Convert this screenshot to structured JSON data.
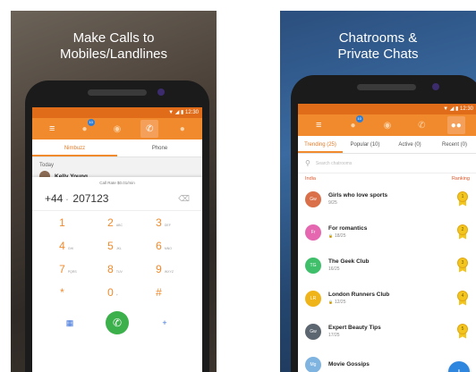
{
  "colors": {
    "accent": "#f08a2c",
    "statusbar": "#e06c19",
    "call_green": "#3cb04a",
    "fab_blue": "#2e86de",
    "ranking_red": "#e0582b"
  },
  "left": {
    "headline": [
      "Make Calls to",
      "Mobiles/Landlines"
    ],
    "status_time": "12:30",
    "tabs": {
      "nimbuzz": "Nimbuzz",
      "phone": "Phone"
    },
    "badge": "10",
    "today": "Today",
    "contact_name": "Kelly Young",
    "call_rate": "Call Rate $0.01/min",
    "country_code": "+44",
    "number": "207123",
    "keys": [
      {
        "digit": "1",
        "letters": ""
      },
      {
        "digit": "2",
        "letters": "ABC"
      },
      {
        "digit": "3",
        "letters": "DEF"
      },
      {
        "digit": "4",
        "letters": "GHI"
      },
      {
        "digit": "5",
        "letters": "JKL"
      },
      {
        "digit": "6",
        "letters": "MNO"
      },
      {
        "digit": "7",
        "letters": "PQRS"
      },
      {
        "digit": "8",
        "letters": "TUV"
      },
      {
        "digit": "9",
        "letters": "WXYZ"
      },
      {
        "digit": "*",
        "letters": ""
      },
      {
        "digit": "0",
        "letters": "+"
      },
      {
        "digit": "#",
        "letters": ""
      }
    ]
  },
  "right": {
    "headline": [
      "Chatrooms &",
      "Private Chats"
    ],
    "status_time": "12:30",
    "badge": "10",
    "tabs": [
      "Trending (25)",
      "Popular (10)",
      "Active (0)",
      "Recent (0)"
    ],
    "search_placeholder": "Search chatrooms",
    "section_label": "India",
    "ranking_label": "Ranking",
    "rooms": [
      {
        "initials": "Gw",
        "name": "Girls who love sports",
        "count": "9/25",
        "locked": false,
        "rank": "1",
        "color": "#d9704a"
      },
      {
        "initials": "Fr",
        "name": "For romantics",
        "count": "18/25",
        "locked": true,
        "rank": "2",
        "color": "#e467b0"
      },
      {
        "initials": "TG",
        "name": "The Geek Club",
        "count": "16/25",
        "locked": false,
        "rank": "3",
        "color": "#3fbf6a"
      },
      {
        "initials": "LR",
        "name": "London Runners Club",
        "count": "12/25",
        "locked": true,
        "rank": "4",
        "color": "#efb419"
      },
      {
        "initials": "Gw",
        "name": "Expert Beauty Tips",
        "count": "17/25",
        "locked": false,
        "rank": "5",
        "color": "#5c6670"
      },
      {
        "initials": "Mg",
        "name": "Movie Gossips",
        "count": "",
        "locked": false,
        "rank": "",
        "color": "#7fb3e0"
      }
    ]
  }
}
